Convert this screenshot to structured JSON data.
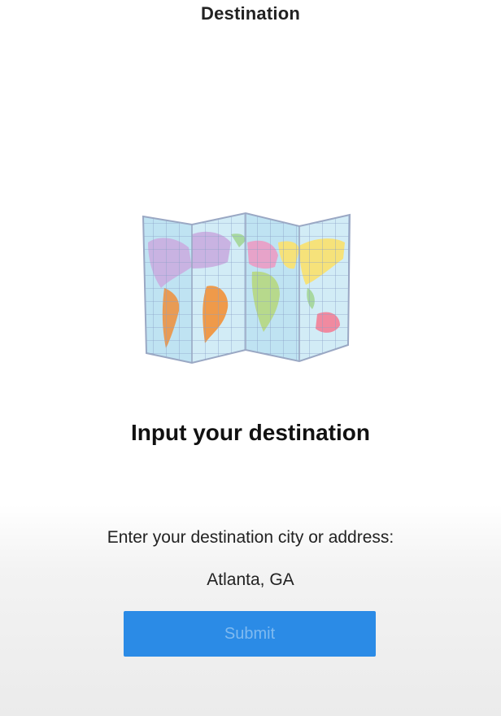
{
  "nav": {
    "title": "Destination"
  },
  "illustration": {
    "icon": "world-map-icon"
  },
  "main": {
    "heading": "Input your destination",
    "prompt": "Enter your destination city or address:",
    "destination_value": "Atlanta, GA",
    "submit_label": "Submit"
  },
  "colors": {
    "accent": "#2b8be6",
    "button_text": "#7fbaf0",
    "text": "#111111"
  }
}
